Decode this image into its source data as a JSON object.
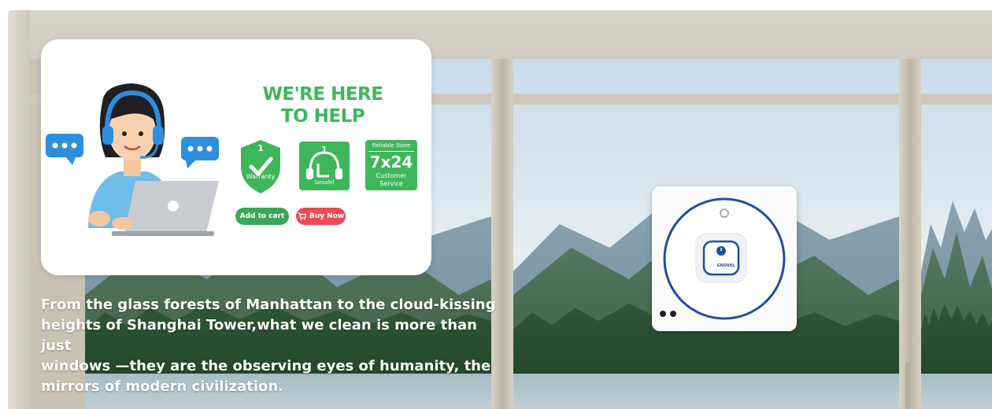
{
  "help_card": {
    "title_line1": "WE'RE HERE",
    "title_line2": "TO HELP",
    "badges": [
      {
        "number": "1",
        "label": "Warranty",
        "icon": "shield-check-icon"
      },
      {
        "number": "1",
        "label": "Sesalel",
        "icon": "headset-icon"
      },
      {
        "top_label": "Reliable Store",
        "big": "7x24",
        "label_line1": "Customer",
        "label_line2": "Service",
        "icon": "clock-badge-icon"
      }
    ],
    "add_to_cart_label": "Add to cart",
    "buy_now_label": "Buy Now",
    "colors": {
      "green": "#3db75a",
      "red": "#ea4b55",
      "headset_blue": "#2d8fdc",
      "shirt_blue": "#6fbde8"
    }
  },
  "caption": {
    "line1": "From the glass forests of Manhattan to the cloud-kissing",
    "line2": "heights of Shanghai Tower,what we clean is more than just",
    "line3": "windows —they are the observing eyes of humanity, the",
    "line4": "mirrors of modern civilization."
  },
  "robot": {
    "brand": "GNOVEL",
    "ring_color": "#1e4fa0"
  }
}
